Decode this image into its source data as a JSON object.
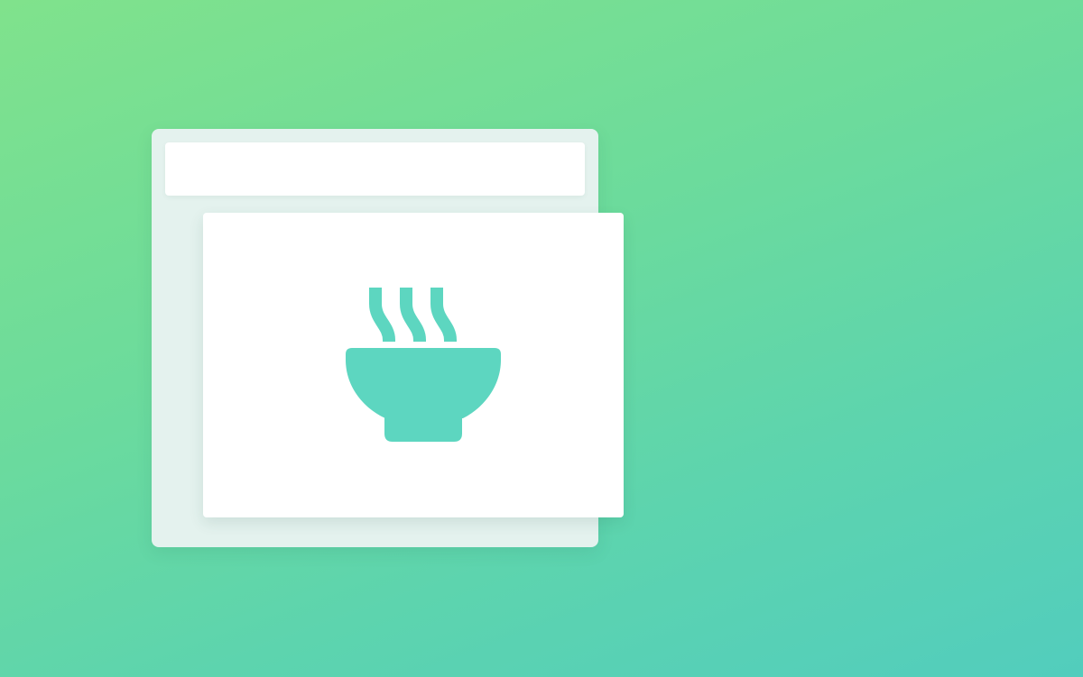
{
  "icons": {
    "main": "bowl-steam-icon"
  },
  "colors": {
    "background_start": "#80e28c",
    "background_end": "#52cdbd",
    "back_window": "#e4f2ee",
    "card": "#ffffff",
    "icon": "#5dd6c0"
  }
}
